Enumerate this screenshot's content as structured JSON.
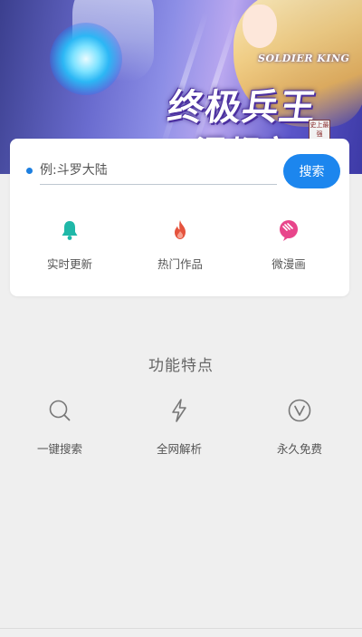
{
  "banner": {
    "subtitle": "SOLDIER KING",
    "title": "终极兵王",
    "title_line2": "混都市",
    "badge": "史上最强"
  },
  "search": {
    "placeholder": "例:斗罗大陆",
    "button_label": "搜索"
  },
  "shortcuts": [
    {
      "label": "实时更新",
      "icon": "bell-icon",
      "color": "#1fb8a8"
    },
    {
      "label": "热门作品",
      "icon": "flame-icon",
      "color": "#e5533d"
    },
    {
      "label": "微漫画",
      "icon": "comic-icon",
      "color": "#e8458b"
    }
  ],
  "features": {
    "title": "功能特点",
    "items": [
      {
        "label": "一键搜索",
        "icon": "search-icon"
      },
      {
        "label": "全网解析",
        "icon": "lightning-icon"
      },
      {
        "label": "永久免费",
        "icon": "v-circle-icon"
      }
    ]
  },
  "colors": {
    "accent": "#1c86ee",
    "background": "#efefef",
    "card": "#ffffff"
  }
}
